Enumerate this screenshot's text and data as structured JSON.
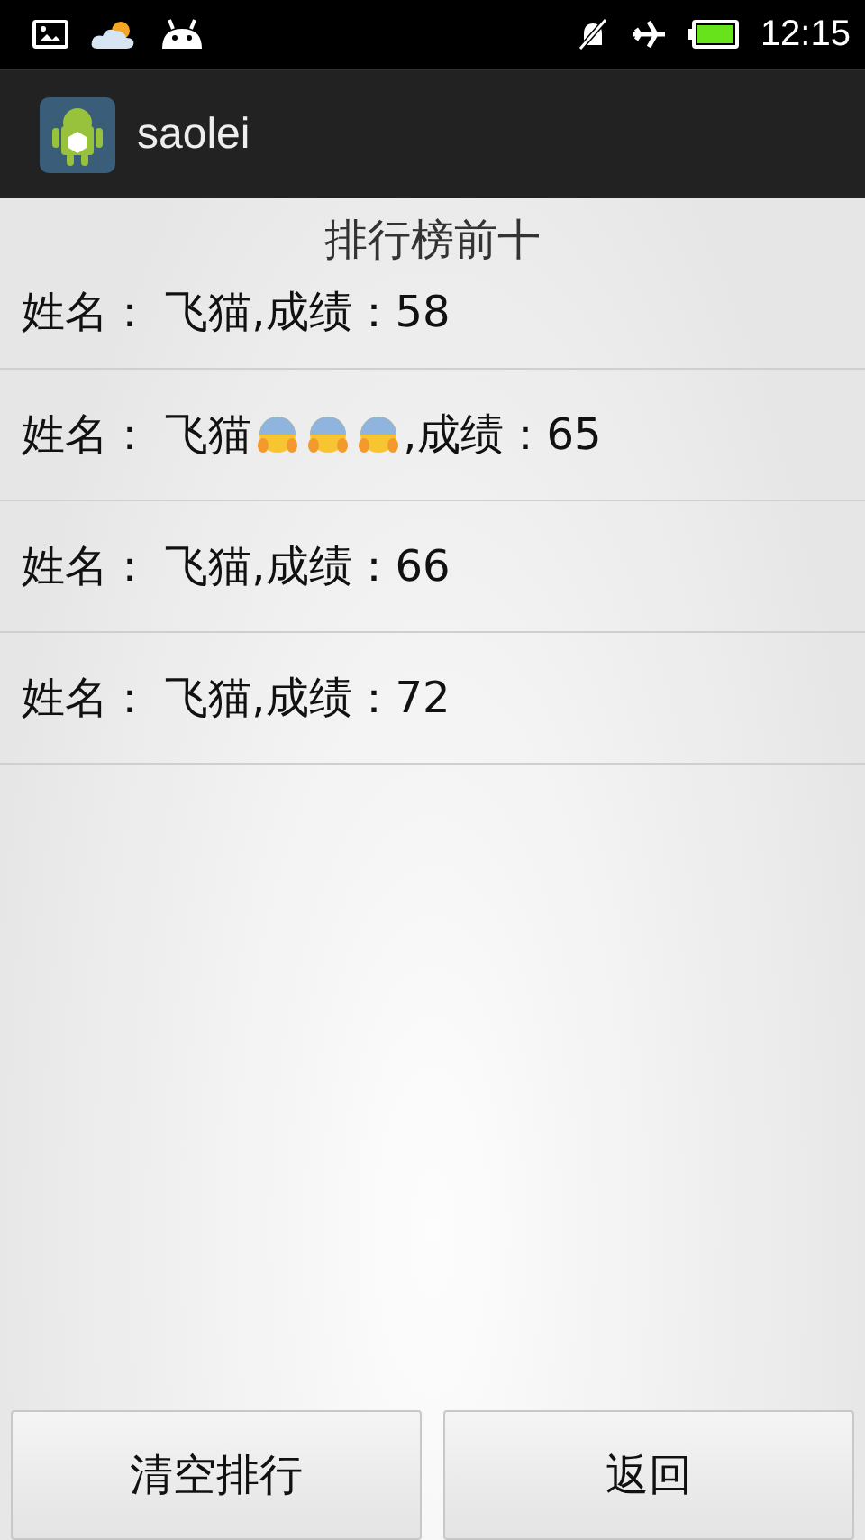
{
  "status_bar": {
    "time": "12:15"
  },
  "action_bar": {
    "title": "saolei"
  },
  "leaderboard": {
    "title": "排行榜前十",
    "rows": [
      {
        "text": "姓名： 飞猫,成绩：58"
      },
      {
        "text": "姓名： 飞猫",
        "icons": [
          {
            "kind": "scream"
          },
          {
            "kind": "scream"
          },
          {
            "kind": "scream"
          }
        ],
        "text_after": ",成绩：65"
      },
      {
        "text": "姓名： 飞猫,成绩：66"
      },
      {
        "text": "姓名： 飞猫,成绩：72"
      }
    ]
  },
  "buttons": [
    {
      "label": "清空排行"
    },
    {
      "label": "返回"
    }
  ]
}
